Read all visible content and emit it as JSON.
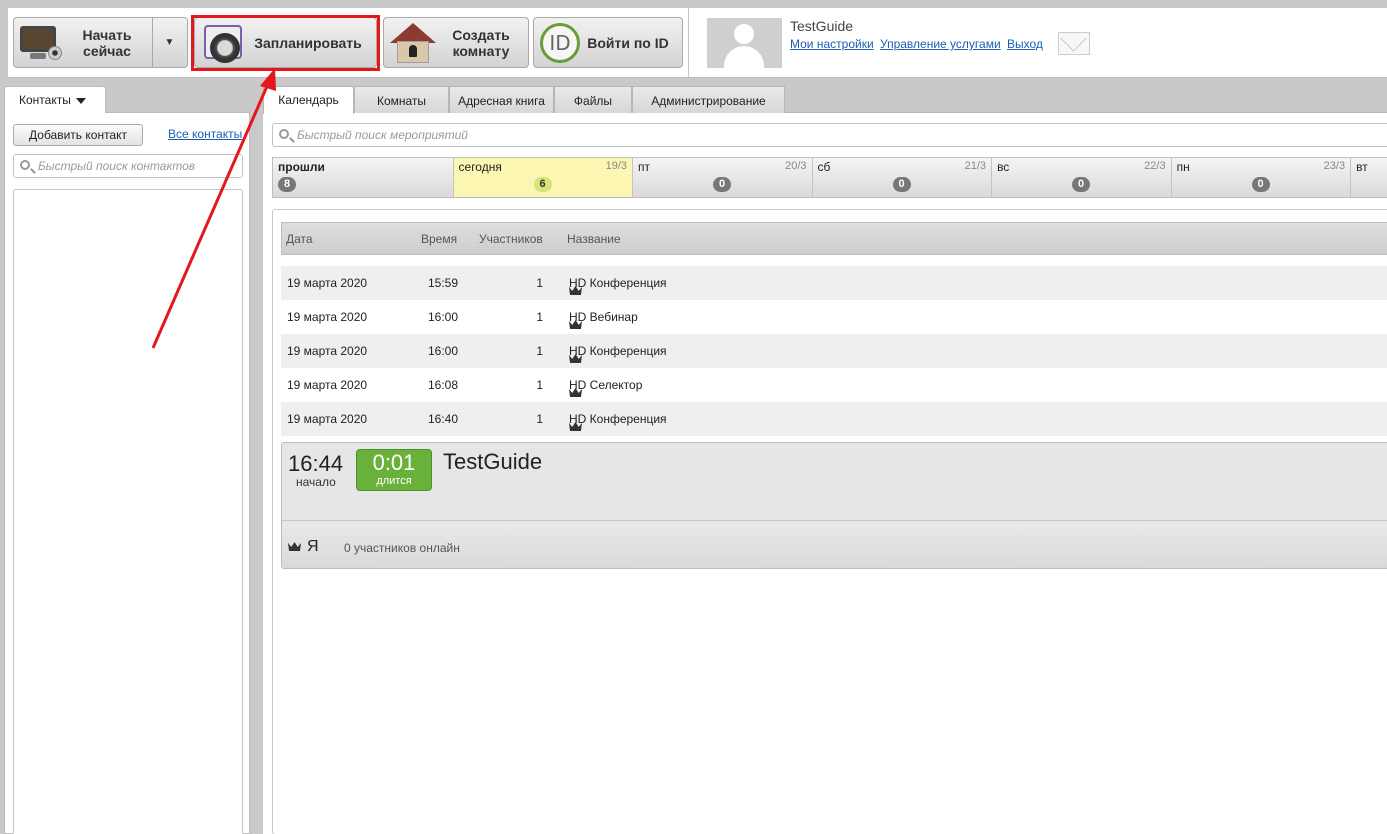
{
  "toolbar": {
    "start_now": "Начать сейчас",
    "schedule": "Запланировать",
    "create_room": "Создать комнату",
    "join_by_id": "Войти по ID",
    "id_glyph": "ID"
  },
  "user": {
    "name": "TestGuide",
    "links": [
      "Мои настройки",
      "Управление услугами",
      "Выход"
    ]
  },
  "contacts": {
    "tab_label": "Контакты",
    "add_button": "Добавить контакт",
    "all_link": "Все контакты",
    "search_placeholder": "Быстрый поиск контактов"
  },
  "tabs": [
    {
      "label": "Календарь",
      "active": true
    },
    {
      "label": "Комнаты",
      "active": false
    },
    {
      "label": "Адресная книга",
      "active": false
    },
    {
      "label": "Файлы",
      "active": false
    },
    {
      "label": "Администрирование",
      "active": false
    }
  ],
  "event_search_placeholder": "Быстрый поиск мероприятий",
  "days": [
    {
      "name": "прошли",
      "date": "",
      "count": "8"
    },
    {
      "name": "сегодня",
      "date": "19/3",
      "count": "6"
    },
    {
      "name": "пт",
      "date": "20/3",
      "count": "0"
    },
    {
      "name": "сб",
      "date": "21/3",
      "count": "0"
    },
    {
      "name": "вс",
      "date": "22/3",
      "count": "0"
    },
    {
      "name": "пн",
      "date": "23/3",
      "count": "0"
    },
    {
      "name": "вт",
      "date": "",
      "count": ""
    }
  ],
  "events_table": {
    "headers": {
      "date": "Дата",
      "time": "Время",
      "participants": "Участников",
      "name": "Название"
    },
    "rows": [
      {
        "date": "19 марта 2020",
        "time": "15:59",
        "participants": "1",
        "name": "HD Конференция"
      },
      {
        "date": "19 марта 2020",
        "time": "16:00",
        "participants": "1",
        "name": "HD Вебинар"
      },
      {
        "date": "19 марта 2020",
        "time": "16:00",
        "participants": "1",
        "name": "HD Конференция"
      },
      {
        "date": "19 марта 2020",
        "time": "16:08",
        "participants": "1",
        "name": "HD Селектор"
      },
      {
        "date": "19 марта 2020",
        "time": "16:40",
        "participants": "1",
        "name": "HD Конференция"
      }
    ]
  },
  "active_event": {
    "start_time": "16:44",
    "start_label": "начало",
    "duration": "0:01",
    "duration_label": "длится",
    "title": "TestGuide",
    "me_label": "Я",
    "online_text": "0 участников онлайн"
  },
  "colors": {
    "highlight_box": "#e2181c",
    "duration_badge": "#6ab13c",
    "today": "#fbf7b2",
    "link": "#1a5fb4"
  },
  "icons": [
    "monitor-webcam-icon",
    "calendar-clock-icon",
    "house-lock-icon",
    "id-circle-icon",
    "chevron-down-icon",
    "envelope-icon",
    "search-icon",
    "crown-icon",
    "user-silhouette-icon"
  ]
}
